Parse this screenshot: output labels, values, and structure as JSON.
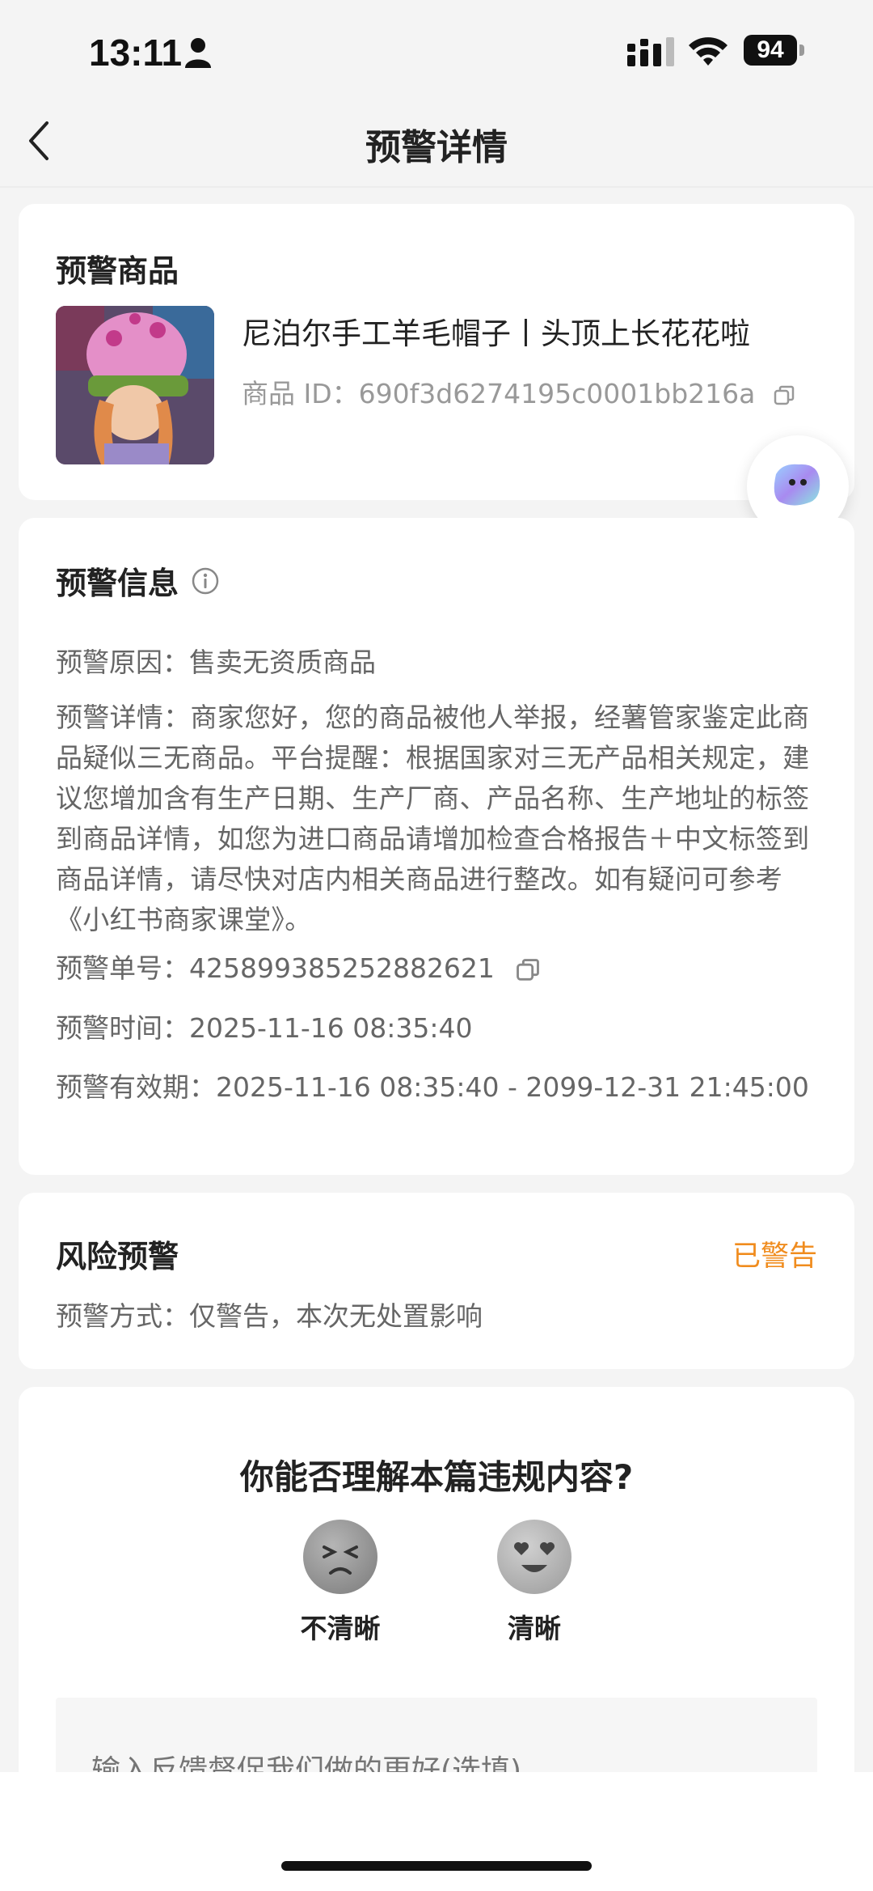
{
  "status_bar": {
    "time": "13:11",
    "battery": "94",
    "icons": [
      "person-icon",
      "signal-icon",
      "wifi-icon",
      "battery-icon"
    ]
  },
  "nav": {
    "title": "预警详情",
    "back_icon": "chevron-left-icon"
  },
  "product": {
    "section_title": "预警商品",
    "name": "尼泊尔手工羊毛帽子丨头顶上长花花啦",
    "id_label": "商品 ID：",
    "id_value": "690f3d6274195c0001bb216a"
  },
  "info": {
    "section_title": "预警信息",
    "reason_label": "预警原因：",
    "reason_value": "售卖无资质商品",
    "detail_text": "预警详情：商家您好，您的商品被他人举报，经薯管家鉴定此商品疑似三无商品。平台提醒：根据国家对三无产品相关规定，建议您增加含有生产日期、生产厂商、产品名称、生产地址的标签到商品详情，如您为进口商品请增加检查合格报告＋中文标签到商品详情，请尽快对店内相关商品进行整改。如有疑问可参考《小红书商家课堂》。",
    "order_label": "预警单号：",
    "order_value": "425899385252882621",
    "time_label": "预警时间：",
    "time_value": "2025-11-16 08:35:40",
    "validity_label": "预警有效期：",
    "validity_value": "2025-11-16 08:35:40 - 2099-12-31 21:45:00"
  },
  "risk": {
    "section_title": "风险预警",
    "status": "已警告",
    "method_label": "预警方式：",
    "method_value": "仅警告，本次无处置影响"
  },
  "feedback": {
    "question": "你能否理解本篇违规内容?",
    "option_unclear": "不清晰",
    "option_clear": "清晰",
    "input_placeholder": "输入反馈督促我们做的更好(选填)"
  },
  "colors": {
    "accent_orange": "#f08c1e",
    "background": "#f4f4f4",
    "card": "#ffffff"
  }
}
